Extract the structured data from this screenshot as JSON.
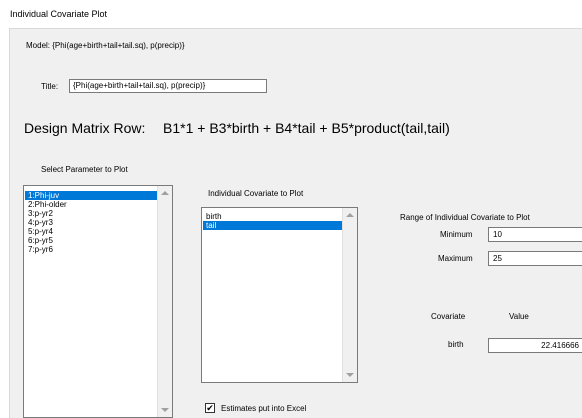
{
  "window": {
    "title": "Individual Covariate Plot"
  },
  "model": {
    "label": "Model:",
    "value": "{Phi(age+birth+tail+tail.sq), p(precip)}"
  },
  "title_field": {
    "label": "Title:",
    "value": "{Phi(age+birth+tail+tail.sq), p(precip)}"
  },
  "design_matrix": {
    "label": "Design Matrix Row:",
    "value": "B1*1 + B3*birth + B4*tail + B5*product(tail,tail)"
  },
  "parameter_list": {
    "label": "Select Parameter to Plot",
    "items": [
      {
        "label": "1:Phi-juv",
        "selected": true
      },
      {
        "label": "2:Phi-older",
        "selected": false
      },
      {
        "label": "3:p-yr2",
        "selected": false
      },
      {
        "label": "4:p-yr3",
        "selected": false
      },
      {
        "label": "5:p-yr4",
        "selected": false
      },
      {
        "label": "6:p-yr5",
        "selected": false
      },
      {
        "label": "7:p-yr6",
        "selected": false
      }
    ]
  },
  "covariate_list": {
    "label": "Individual Covariate to Plot",
    "items": [
      {
        "label": "birth",
        "selected": false
      },
      {
        "label": "tail",
        "selected": true
      }
    ]
  },
  "range": {
    "label": "Range of Individual Covariate to Plot",
    "min_label": "Minimum",
    "min_value": "10",
    "max_label": "Maximum",
    "max_value": "25"
  },
  "covariate_values": {
    "covariate_header": "Covariate",
    "value_header": "Value",
    "rows": [
      {
        "name": "birth",
        "value": "22.416666"
      }
    ]
  },
  "excel": {
    "label": "Estimates put into Excel",
    "checked": true,
    "check_mark": "✔"
  }
}
